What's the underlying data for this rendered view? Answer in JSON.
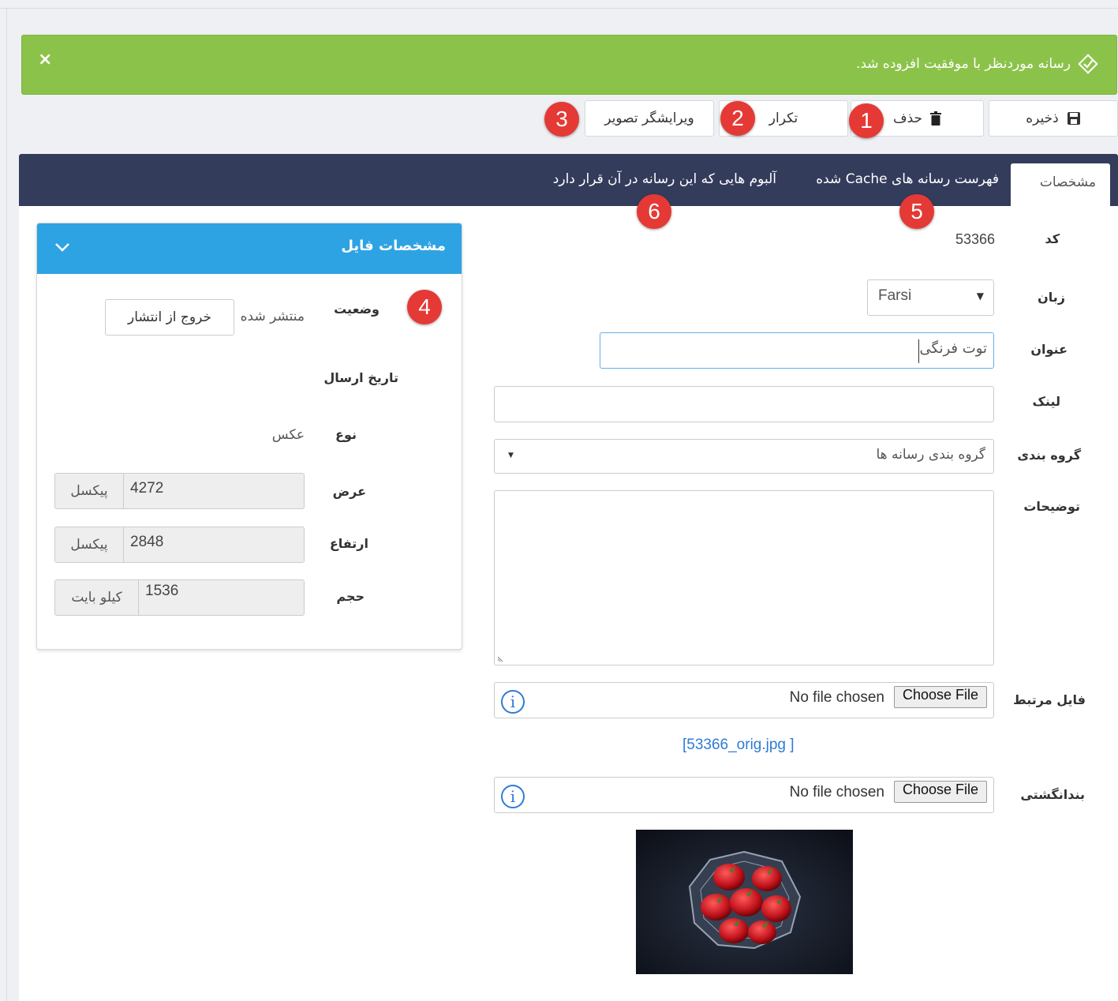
{
  "alert": {
    "message": "رسانه موردنظر با موفقیت افزوده شد.",
    "close_icon": "×"
  },
  "toolbar": {
    "save_label": "ذخیره",
    "delete_label": "حذف",
    "duplicate_label": "تکرار",
    "image_editor_label": "ویرایشگر تصویر"
  },
  "annotations": [
    "1",
    "2",
    "3",
    "4",
    "5",
    "6"
  ],
  "tabs": {
    "specs": "مشخصات",
    "cached_list": "فهرست رسانه های Cache شده",
    "albums": "آلبوم هایی که این رسانه در آن قرار دارد"
  },
  "form": {
    "code_label": "کد",
    "code_value": "53366",
    "language_label": "زبان",
    "language_value": "Farsi",
    "title_label": "عنوان",
    "title_value": "توت فرنگی",
    "link_label": "لینک",
    "link_value": "",
    "category_label": "گروه بندی",
    "category_placeholder": "گروه بندی رسانه ها",
    "description_label": "توضیحات",
    "description_value": "",
    "related_file_label": "فایل مرتبط",
    "related_file_status": "No file chosen",
    "choose_file_label": "Choose File",
    "related_file_link": "[53366_orig.jpg ]",
    "thumbnail_label": "بندانگشتی",
    "thumbnail_status": "No file chosen"
  },
  "file_panel": {
    "title": "مشخصات فایل",
    "status_label": "وضعیت",
    "status_value": "منتشر شده",
    "unpublish_label": "خروج از انتشار",
    "date_label": "تاریخ ارسال",
    "type_label": "نوع",
    "type_value": "عکس",
    "width_label": "عرض",
    "width_value": "4272",
    "width_unit": "پیکسل",
    "height_label": "ارتفاع",
    "height_value": "2848",
    "height_unit": "پیکسل",
    "size_label": "حجم",
    "size_value": "1536",
    "size_unit": "کیلو بایت"
  },
  "colors": {
    "alert_green": "#8bc34a",
    "tabbar_navy": "#343c5c",
    "panel_header_blue": "#2ea3e3",
    "badge_red": "#e53935",
    "link_blue": "#2f7bd6"
  }
}
